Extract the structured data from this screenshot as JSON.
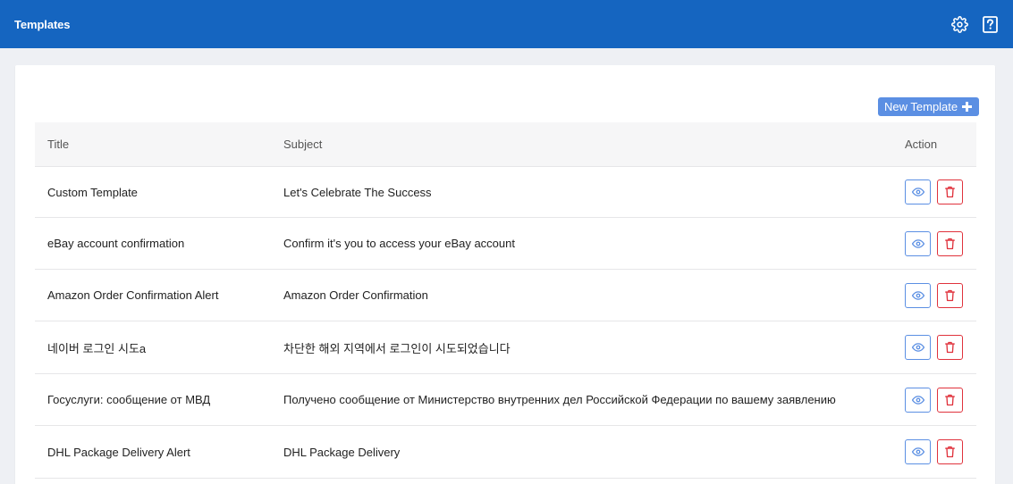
{
  "header": {
    "title": "Templates",
    "icons": [
      "gear-icon",
      "help-icon"
    ]
  },
  "toolbar": {
    "new_template_label": "New Template"
  },
  "table": {
    "columns": [
      "Title",
      "Subject",
      "Action"
    ],
    "rows": [
      {
        "title": "Custom Template",
        "subject": "Let's Celebrate The Success"
      },
      {
        "title": "eBay account confirmation",
        "subject": "Confirm it's you to access your eBay account"
      },
      {
        "title": "Amazon Order Confirmation Alert",
        "subject": "Amazon Order Confirmation"
      },
      {
        "title": "네이버 로그인 시도a",
        "subject": "차단한 해외 지역에서 로그인이 시도되었습니다"
      },
      {
        "title": "Госуслуги: сообщение от МВД",
        "subject": "Получено сообщение от Министерство внутренних дел Российской Федерации по вашему заявлению"
      },
      {
        "title": "DHL Package Delivery Alert",
        "subject": "DHL Package Delivery"
      }
    ]
  },
  "colors": {
    "header_bg": "#1565c0",
    "primary": "#5b8fe3",
    "danger": "#e0323c"
  }
}
